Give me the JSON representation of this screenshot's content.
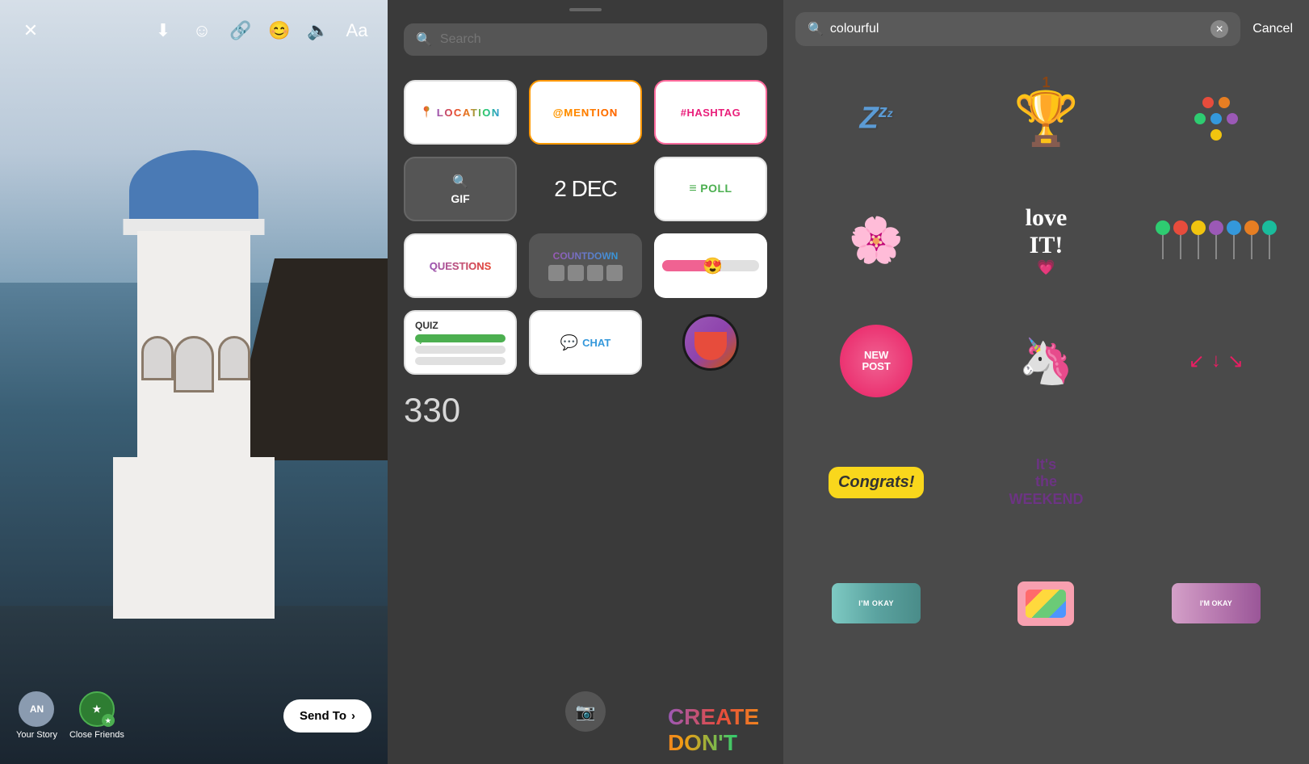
{
  "panel1": {
    "toolbar": {
      "close_label": "✕",
      "download_label": "⬇",
      "emoji_label": "☺",
      "link_label": "🔗",
      "face_label": "😊",
      "audio_label": "🔈",
      "text_label": "Aa"
    },
    "bottom": {
      "your_story_label": "Your Story",
      "close_friends_label": "Close Friends",
      "send_to_label": "Send To",
      "send_arrow": "›"
    }
  },
  "panel2": {
    "search_placeholder": "Search",
    "stickers": {
      "row1": [
        {
          "id": "location",
          "text": "LOCATION",
          "prefix": "📍"
        },
        {
          "id": "mention",
          "text": "@MENTION"
        },
        {
          "id": "hashtag",
          "text": "#HASHTAG"
        }
      ],
      "row2": [
        {
          "id": "gif",
          "text": "GIF"
        },
        {
          "id": "date",
          "text": "2 DEC"
        },
        {
          "id": "poll",
          "text": "POLL"
        }
      ],
      "row3": [
        {
          "id": "questions",
          "text": "QUESTIONS"
        },
        {
          "id": "countdown",
          "text": "COUNTDOWN"
        },
        {
          "id": "slider",
          "emoji": "😍"
        }
      ],
      "row4": [
        {
          "id": "quiz",
          "text": "QUIZ"
        },
        {
          "id": "chat",
          "text": "CHAT"
        },
        {
          "id": "voice",
          "text": ""
        }
      ]
    },
    "bottom_partial": {
      "countdown_digits": "330",
      "create_dont": "CREATE\nDON'T"
    }
  },
  "panel3": {
    "search_value": "colourful",
    "cancel_label": "Cancel",
    "stickers": [
      {
        "id": "zzz",
        "type": "zzz"
      },
      {
        "id": "trophy",
        "type": "trophy"
      },
      {
        "id": "dots",
        "type": "dots"
      },
      {
        "id": "flower",
        "type": "flower"
      },
      {
        "id": "love-it",
        "type": "love-it"
      },
      {
        "id": "lollipops",
        "type": "lollipops"
      },
      {
        "id": "new-post",
        "type": "new-post",
        "line1": "NEW",
        "line2": "POST"
      },
      {
        "id": "rainbow",
        "type": "rainbow"
      },
      {
        "id": "arrows",
        "type": "arrows"
      },
      {
        "id": "congrats",
        "type": "congrats",
        "text": "Congrats!"
      },
      {
        "id": "weekend",
        "type": "weekend",
        "text": "It's the WEEKEND"
      },
      {
        "id": "empty",
        "type": "empty"
      },
      {
        "id": "roll1",
        "type": "roll1",
        "text": "I'M OKAY"
      },
      {
        "id": "palette",
        "type": "palette"
      },
      {
        "id": "roll2",
        "type": "roll2",
        "text": "I'M OKAY"
      }
    ]
  }
}
